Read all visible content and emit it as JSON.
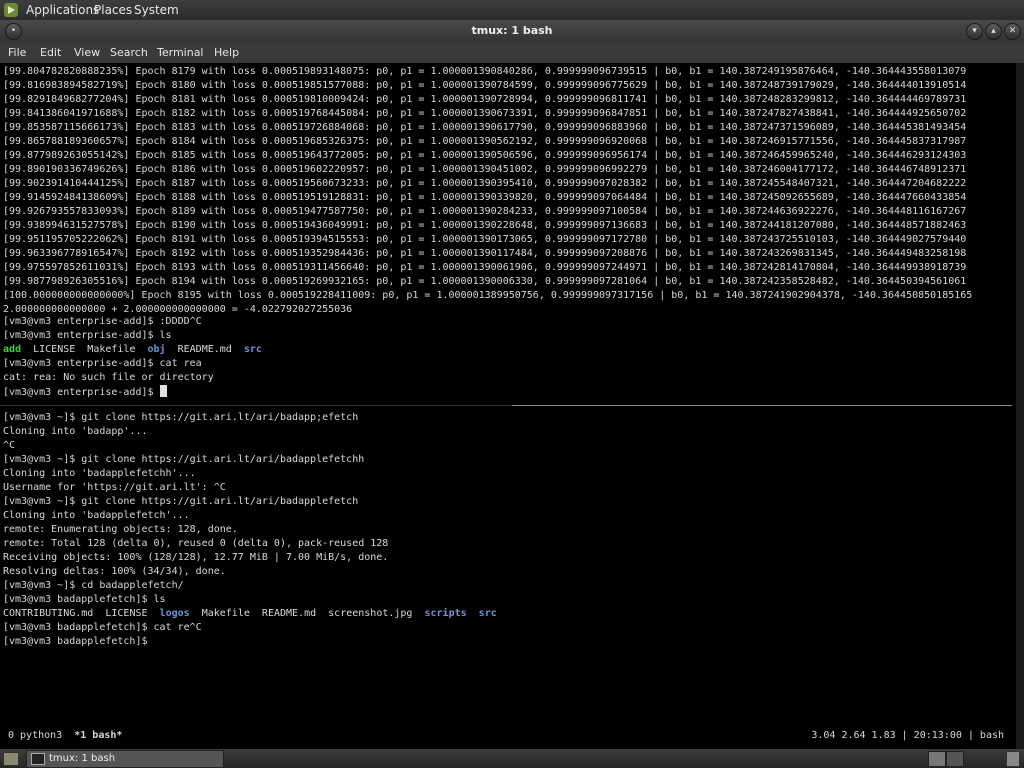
{
  "top_panel": {
    "applications": "Applications",
    "places": "Places",
    "system": "System"
  },
  "window": {
    "title": "tmux: 1 bash"
  },
  "menubar": [
    "File",
    "Edit",
    "View",
    "Search",
    "Terminal",
    "Help"
  ],
  "training_lines": [
    "[99.804782820888235%] Epoch 8179 with loss 0.000519893148075: p0, p1 = 1.000001390840286, 0.999999096739515 | b0, b1 = 140.387249195876464, -140.364443558013079",
    "[99.816983894582719%] Epoch 8180 with loss 0.000519851577088: p0, p1 = 1.000001390784599, 0.999999096775629 | b0, b1 = 140.387248739179029, -140.364444013910514",
    "[99.829184968277204%] Epoch 8181 with loss 0.000519810009424: p0, p1 = 1.000001390728994, 0.999999096811741 | b0, b1 = 140.387248283299812, -140.364444469789731",
    "[99.841386041971688%] Epoch 8182 with loss 0.000519768445084: p0, p1 = 1.000001390673391, 0.999999096847851 | b0, b1 = 140.387247827438841, -140.364444925650702",
    "[99.853587115666173%] Epoch 8183 with loss 0.000519726884068: p0, p1 = 1.000001390617790, 0.999999096883960 | b0, b1 = 140.387247371596089, -140.364445381493454",
    "[99.865788189360657%] Epoch 8184 with loss 0.000519685326375: p0, p1 = 1.000001390562192, 0.999999096920068 | b0, b1 = 140.387246915771556, -140.364445837317987",
    "[99.877989263055142%] Epoch 8185 with loss 0.000519643772005: p0, p1 = 1.000001390506596, 0.999999096956174 | b0, b1 = 140.387246459965240, -140.364446293124303",
    "[99.890190336749626%] Epoch 8186 with loss 0.000519602220957: p0, p1 = 1.000001390451002, 0.999999096992279 | b0, b1 = 140.387246004177172, -140.364446748912371",
    "[99.902391410444125%] Epoch 8187 with loss 0.000519560673233: p0, p1 = 1.000001390395410, 0.999999097028382 | b0, b1 = 140.387245548407321, -140.364447204682222",
    "[99.914592484138609%] Epoch 8188 with loss 0.000519519128831: p0, p1 = 1.000001390339820, 0.999999097064484 | b0, b1 = 140.387245092655689, -140.364447660433854",
    "[99.926793557833093%] Epoch 8189 with loss 0.000519477587750: p0, p1 = 1.000001390284233, 0.999999097100584 | b0, b1 = 140.387244636922276, -140.364448116167267",
    "[99.938994631527578%] Epoch 8190 with loss 0.000519436049991: p0, p1 = 1.000001390228648, 0.999999097136683 | b0, b1 = 140.387244181207080, -140.364448571882463",
    "[99.951195705222062%] Epoch 8191 with loss 0.000519394515553: p0, p1 = 1.000001390173065, 0.999999097172780 | b0, b1 = 140.387243725510103, -140.364449027579440",
    "[99.963396778916547%] Epoch 8192 with loss 0.000519352984436: p0, p1 = 1.000001390117484, 0.999999097208876 | b0, b1 = 140.387243269831345, -140.364449483258198",
    "[99.975597852611031%] Epoch 8193 with loss 0.000519311456640: p0, p1 = 1.000001390061906, 0.999999097244971 | b0, b1 = 140.387242814170804, -140.364449938918739",
    "[99.987798926305516%] Epoch 8194 with loss 0.000519269932165: p0, p1 = 1.000001390006330, 0.999999097281064 | b0, b1 = 140.387242358528482, -140.364450394561061",
    "[100.000000000000000%] Epoch 8195 with loss 0.000519228411009: p0, p1 = 1.000001389950756, 0.999999097317156 | b0, b1 = 140.387241902904378, -140.364450850185165",
    "2.000000000000000 + 2.000000000000000 = -4.022792027255036"
  ],
  "top_pane": {
    "prompt1": "[vm3@vm3 enterprise-add]$ :DDDD^C",
    "prompt2": "[vm3@vm3 enterprise-add]$ ls",
    "ls_entries": [
      {
        "name": "add",
        "color": "green",
        "bold": true
      },
      {
        "name": "LICENSE",
        "color": "",
        "bold": false
      },
      {
        "name": "Makefile",
        "color": "",
        "bold": false
      },
      {
        "name": "obj",
        "color": "blue",
        "bold": true
      },
      {
        "name": "README.md",
        "color": "",
        "bold": false
      },
      {
        "name": "src",
        "color": "blue",
        "bold": true
      }
    ],
    "prompt3": "[vm3@vm3 enterprise-add]$ cat rea",
    "error": "cat: rea: No such file or directory",
    "prompt4": "[vm3@vm3 enterprise-add]$ "
  },
  "bottom_pane": {
    "lines": [
      "[vm3@vm3 ~]$ git clone https://git.ari.lt/ari/badapp;efetch",
      "Cloning into 'badapp'...",
      "^C",
      "[vm3@vm3 ~]$ git clone https://git.ari.lt/ari/badapplefetchh",
      "Cloning into 'badapplefetchh'...",
      "Username for 'https://git.ari.lt': ^C",
      "[vm3@vm3 ~]$ git clone https://git.ari.lt/ari/badapplefetch",
      "Cloning into 'badapplefetch'...",
      "remote: Enumerating objects: 128, done.",
      "remote: Total 128 (delta 0), reused 0 (delta 0), pack-reused 128",
      "Receiving objects: 100% (128/128), 12.77 MiB | 7.00 MiB/s, done.",
      "Resolving deltas: 100% (34/34), done.",
      "[vm3@vm3 ~]$ cd badapplefetch/",
      "[vm3@vm3 badapplefetch]$ ls"
    ],
    "ls_entries": [
      {
        "name": "CONTRIBUTING.md",
        "color": "",
        "bold": false
      },
      {
        "name": "LICENSE",
        "color": "",
        "bold": false
      },
      {
        "name": "logos",
        "color": "blue",
        "bold": true
      },
      {
        "name": "Makefile",
        "color": "",
        "bold": false
      },
      {
        "name": "README.md",
        "color": "",
        "bold": false
      },
      {
        "name": "screenshot.jpg",
        "color": "",
        "bold": false
      },
      {
        "name": "scripts",
        "color": "blue",
        "bold": true
      },
      {
        "name": "src",
        "color": "blue",
        "bold": true
      }
    ],
    "after_lines": [
      "[vm3@vm3 badapplefetch]$ cat re^C",
      "[vm3@vm3 badapplefetch]$"
    ]
  },
  "status_bar": {
    "windows": "0 python3  *1 bash*",
    "right": "3.04 2.64 1.83 | 20:13:00 | bash"
  },
  "taskbar": {
    "task": "tmux: 1 bash"
  }
}
